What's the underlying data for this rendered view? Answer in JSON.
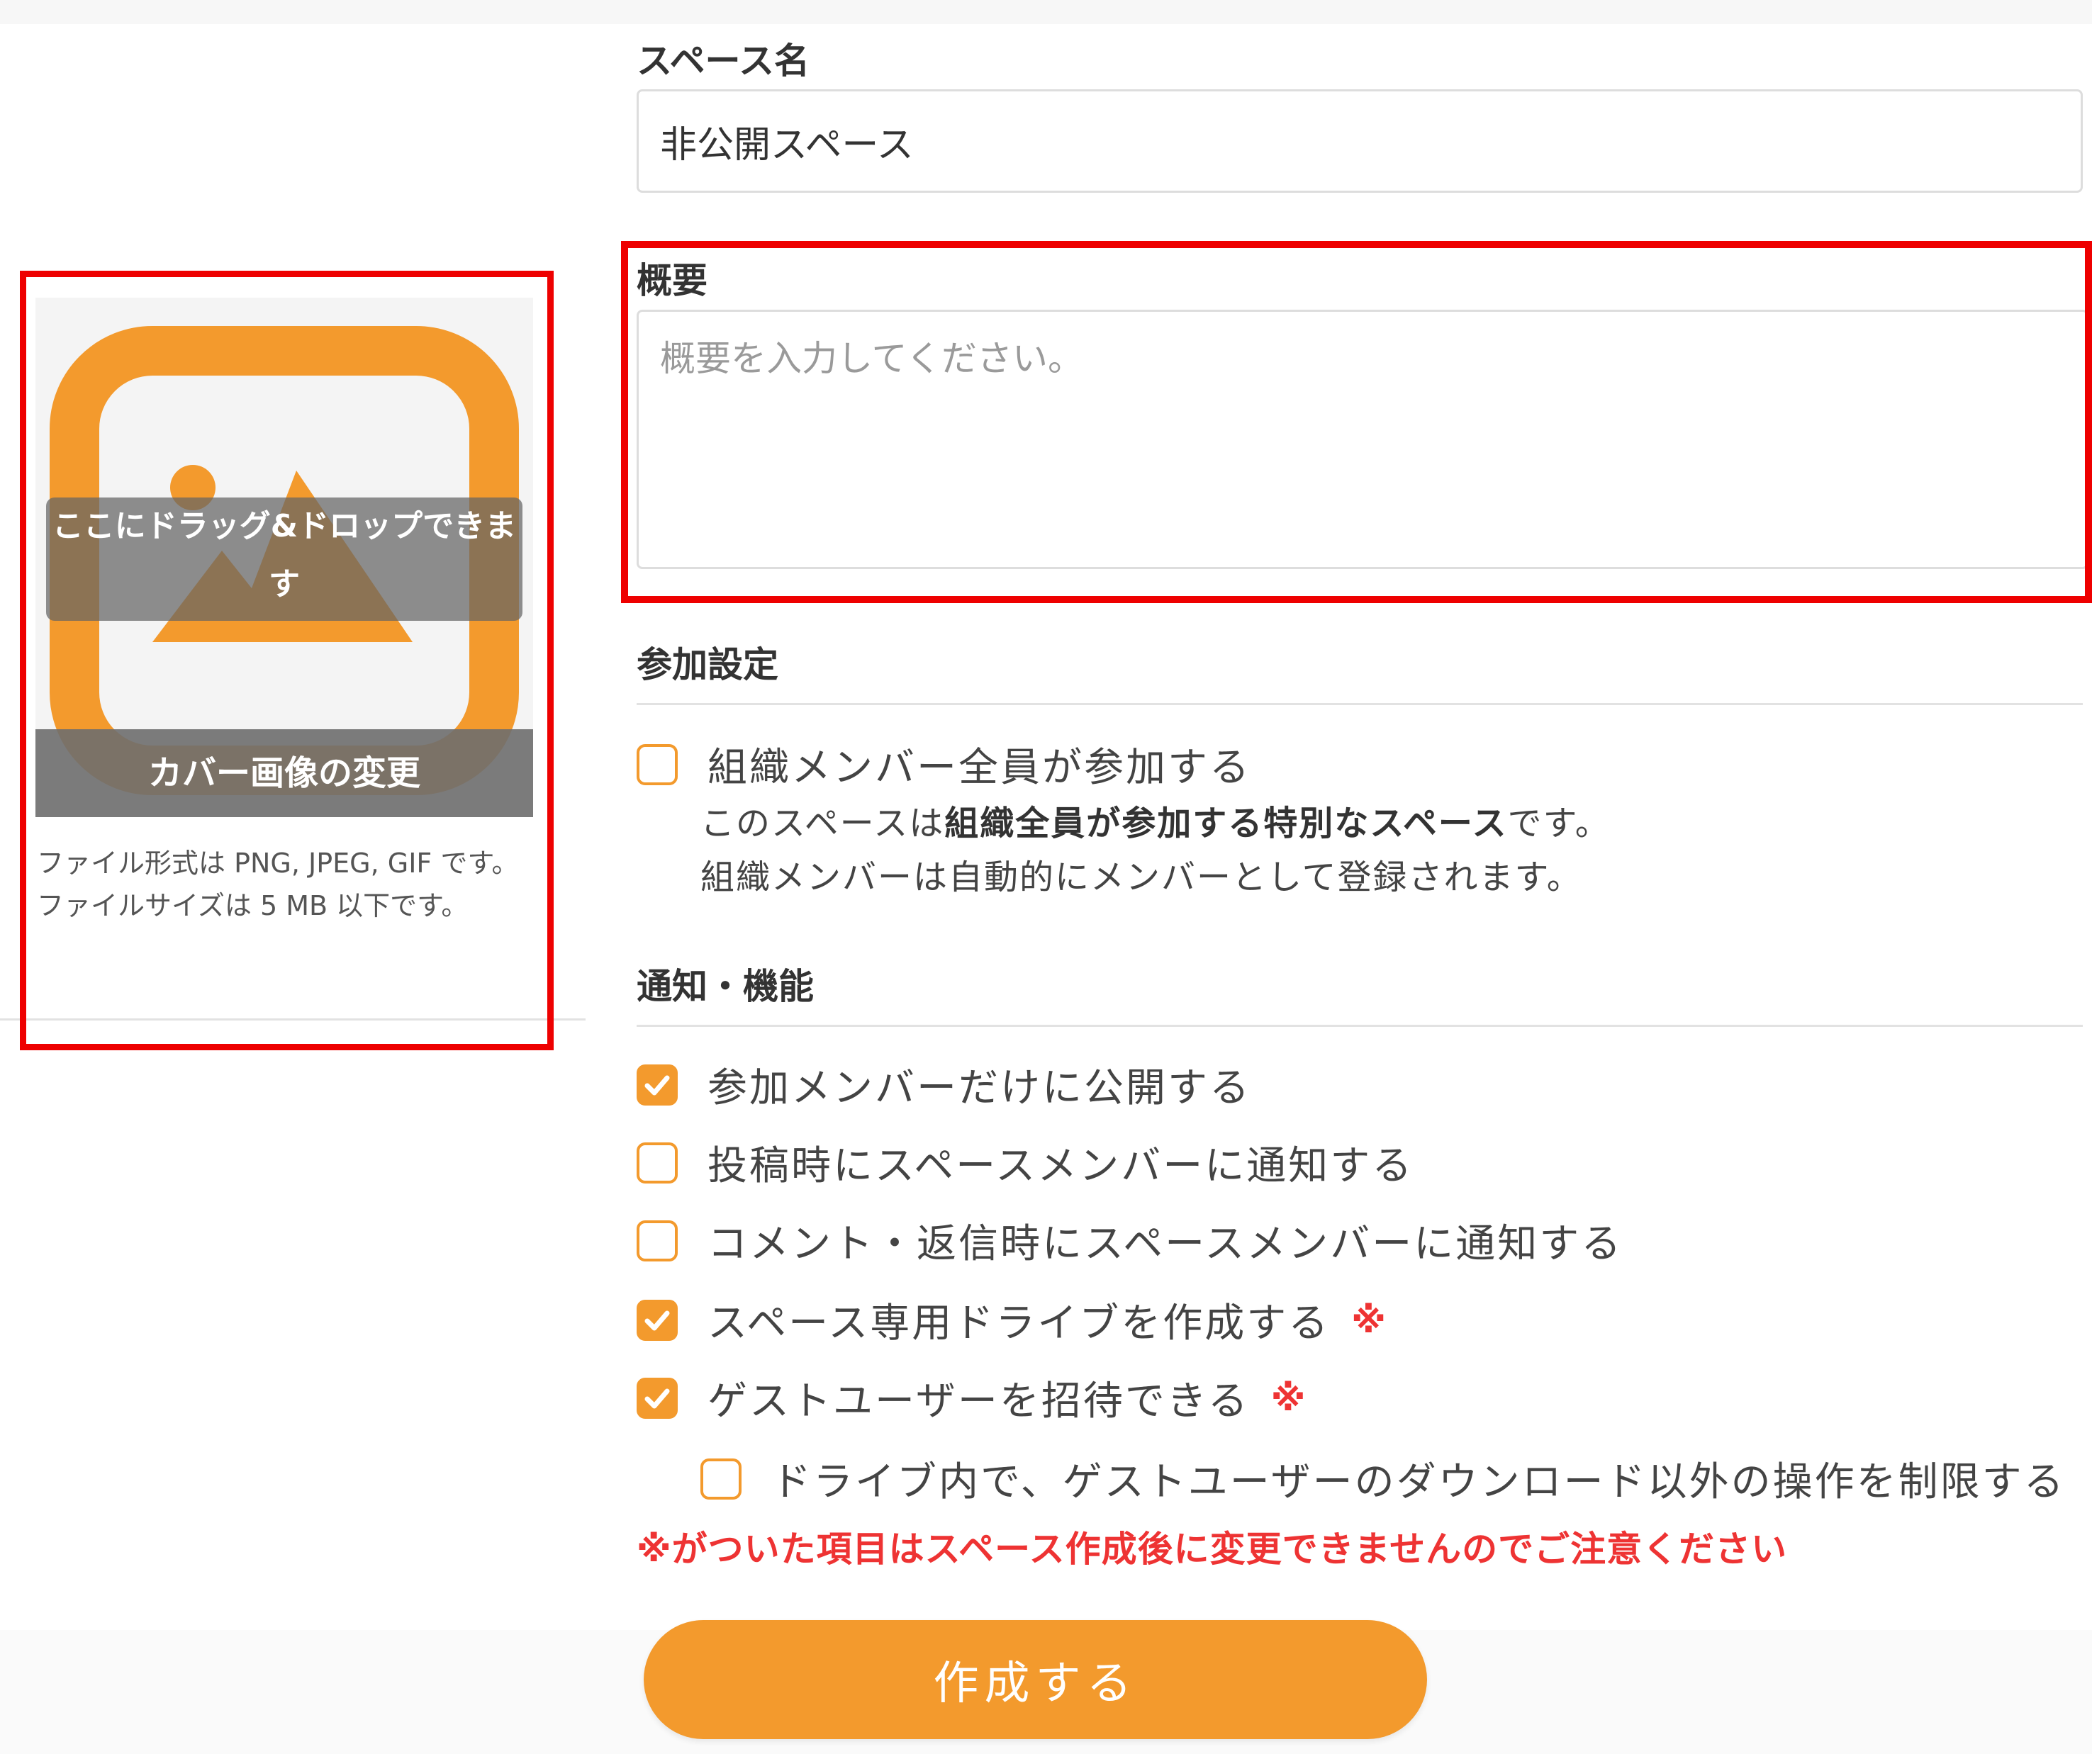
{
  "cover": {
    "drop_hint": "ここにドラッグ&ドロップできます",
    "change_label": "カバー画像の変更",
    "file_note_1": "ファイル形式は PNG, JPEG, GIF です。",
    "file_note_2": "ファイルサイズは 5 MB 以下です。",
    "icon": "image-icon",
    "accent_color": "#f39a2d"
  },
  "space_name": {
    "label": "スペース名",
    "value": "非公開スペース"
  },
  "description": {
    "label": "概要",
    "placeholder": "概要を入力してください。"
  },
  "participation": {
    "heading": "参加設定",
    "all_members": {
      "label": "組織メンバー全員が参加する",
      "checked": false
    },
    "desc_prefix": "このスペースは",
    "desc_bold": "組織全員が参加する特別なスペース",
    "desc_suffix": "です。",
    "desc_line2": "組織メンバーは自動的にメンバーとして登録されます。"
  },
  "notifications": {
    "heading": "通知・機能",
    "options": [
      {
        "label": "参加メンバーだけに公開する",
        "checked": true,
        "mark": ""
      },
      {
        "label": "投稿時にスペースメンバーに通知する",
        "checked": false,
        "mark": ""
      },
      {
        "label": "コメント・返信時にスペースメンバーに通知する",
        "checked": false,
        "mark": ""
      },
      {
        "label": "スペース専用ドライブを作成する",
        "checked": true,
        "mark": "※"
      },
      {
        "label": "ゲストユーザーを招待できる",
        "checked": true,
        "mark": "※"
      }
    ],
    "sub_option": {
      "label": "ドライブ内で、ゲストユーザーのダウンロード以外の操作を制限する",
      "checked": false
    }
  },
  "warning": "※がついた項目はスペース作成後に変更できませんのでご注意ください",
  "submit": {
    "label": "作成する"
  }
}
